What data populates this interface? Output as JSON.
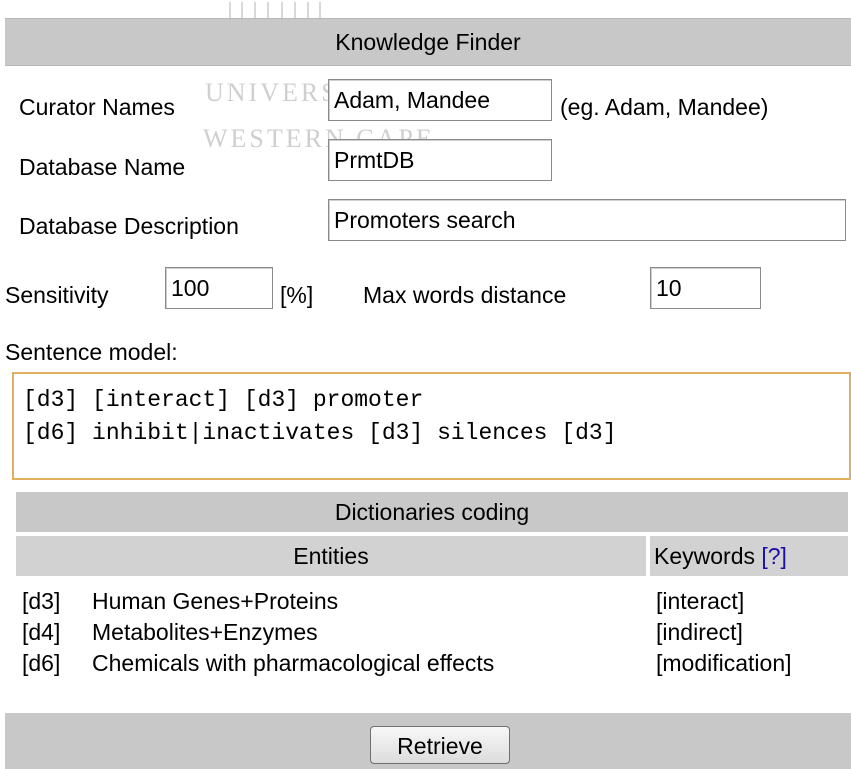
{
  "watermark": {
    "line1": "UNIVERSITY of the",
    "line2": "WESTERN CAPE"
  },
  "form": {
    "title": "Knowledge Finder",
    "curator_label": "Curator Names",
    "curator_value": "Adam, Mandee",
    "curator_hint": "(eg. Adam, Mandee)",
    "db_name_label": "Database Name",
    "db_name_value": "PrmtDB",
    "db_desc_label": "Database Description",
    "db_desc_value": "Promoters search",
    "sensitivity_label": "Sensitivity",
    "sensitivity_value": "100",
    "sensitivity_unit": "[%]",
    "max_words_label": "Max words distance",
    "max_words_value": "10",
    "sentence_label": "Sentence model:",
    "sentence_value": "[d3] [interact] [d3] promoter\n[d6] inhibit|inactivates [d3] silences [d3]"
  },
  "dictionaries": {
    "title": "Dictionaries coding",
    "entities_header": "Entities",
    "keywords_header": "Keywords",
    "help_link": "[?]",
    "rows": [
      {
        "code": "[d3]",
        "name": "Human Genes+Proteins",
        "keyword": "[interact]"
      },
      {
        "code": "[d4]",
        "name": "Metabolites+Enzymes",
        "keyword": "[indirect]"
      },
      {
        "code": "[d6]",
        "name": "Chemicals with pharmacological effects",
        "keyword": "[modification]"
      }
    ]
  },
  "actions": {
    "retrieve_label": "Retrieve"
  }
}
